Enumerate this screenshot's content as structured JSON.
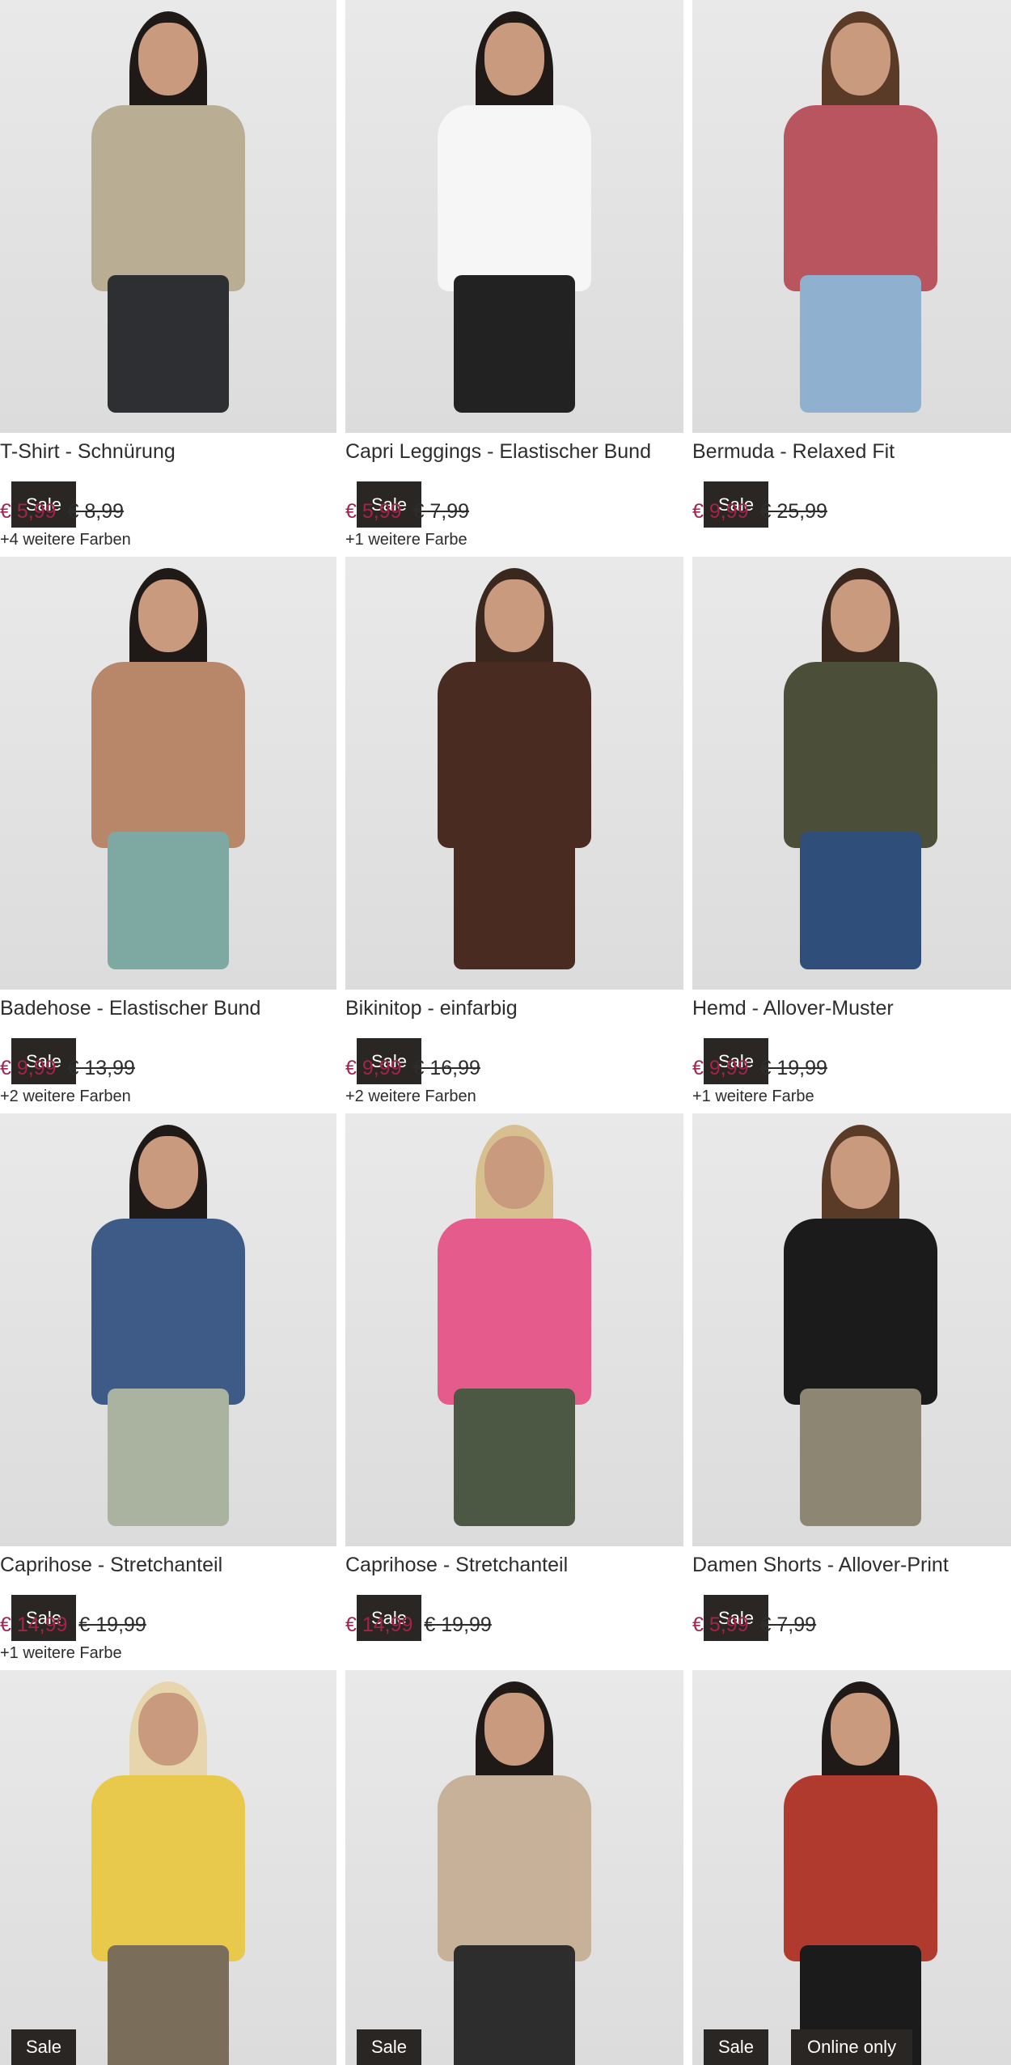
{
  "products": [
    {
      "title": "T-Shirt - Schnürung",
      "price": "€ 5,99",
      "old_price": "€ 8,99",
      "colors": "+4 weitere Farben",
      "badge": "Sale",
      "top_color": "#b9ad94",
      "bottom_color": "#2e2f33",
      "hair_color": "#1f1a17"
    },
    {
      "title": "Capri Leggings - Elastischer Bund",
      "price": "€ 5,99",
      "old_price": "€ 7,99",
      "colors": "+1 weitere Farbe",
      "badge": "Sale",
      "top_color": "#f6f6f6",
      "bottom_color": "#222222",
      "hair_color": "#1f1a17"
    },
    {
      "title": "Bermuda - Relaxed Fit",
      "price": "€ 9,99",
      "old_price": "€ 25,99",
      "colors": "",
      "badge": "Sale",
      "top_color": "#b9555f",
      "bottom_color": "#8fb0cf",
      "hair_color": "#5a3b28"
    },
    {
      "title": "Badehose - Elastischer Bund",
      "price": "€ 9,99",
      "old_price": "€ 13,99",
      "colors": "+2 weitere Farben",
      "badge": "Sale",
      "top_color": "#b88769",
      "bottom_color": "#7ea8a2",
      "hair_color": "#1f1a17"
    },
    {
      "title": "Bikinitop - einfarbig",
      "price": "€ 9,99",
      "old_price": "€ 16,99",
      "colors": "+2 weitere Farben",
      "badge": "Sale",
      "top_color": "#4a2b22",
      "bottom_color": "#4a2b22",
      "hair_color": "#3a271d"
    },
    {
      "title": "Hemd - Allover-Muster",
      "price": "€ 9,99",
      "old_price": "€ 19,99",
      "colors": "+1 weitere Farbe",
      "badge": "Sale",
      "top_color": "#4b4f3a",
      "bottom_color": "#2f4f7a",
      "hair_color": "#3a271d"
    },
    {
      "title": "Caprihose - Stretchanteil",
      "price": "€ 14,99",
      "old_price": "€ 19,99",
      "colors": "+1 weitere Farbe",
      "badge": "Sale",
      "top_color": "#3e5a86",
      "bottom_color": "#a9b3a0",
      "hair_color": "#1f1a17"
    },
    {
      "title": "Caprihose - Stretchanteil",
      "price": "€ 14,99",
      "old_price": "€ 19,99",
      "colors": "",
      "badge": "Sale",
      "top_color": "#e45b8c",
      "bottom_color": "#4c5843",
      "hair_color": "#d8bf8f"
    },
    {
      "title": "Damen Shorts - Allover-Print",
      "price": "€ 5,99",
      "old_price": "€ 7,99",
      "colors": "",
      "badge": "Sale",
      "top_color": "#1b1b1b",
      "bottom_color": "#8c8672",
      "hair_color": "#5a3b28"
    },
    {
      "title": "",
      "price": "",
      "old_price": "",
      "colors": "",
      "badge": "Sale",
      "top_color": "#e8c94b",
      "bottom_color": "#7a6d5a",
      "hair_color": "#e7d6ad"
    },
    {
      "title": "",
      "price": "",
      "old_price": "",
      "colors": "",
      "badge": "Sale",
      "top_color": "#c7b299",
      "bottom_color": "#2d2d2d",
      "hair_color": "#1f1a17"
    },
    {
      "title": "",
      "price": "",
      "old_price": "",
      "colors": "",
      "badge": "Sale",
      "badge2": "Online only",
      "top_color": "#b13a2f",
      "bottom_color": "#1b1b1b",
      "hair_color": "#1f1a17"
    }
  ]
}
